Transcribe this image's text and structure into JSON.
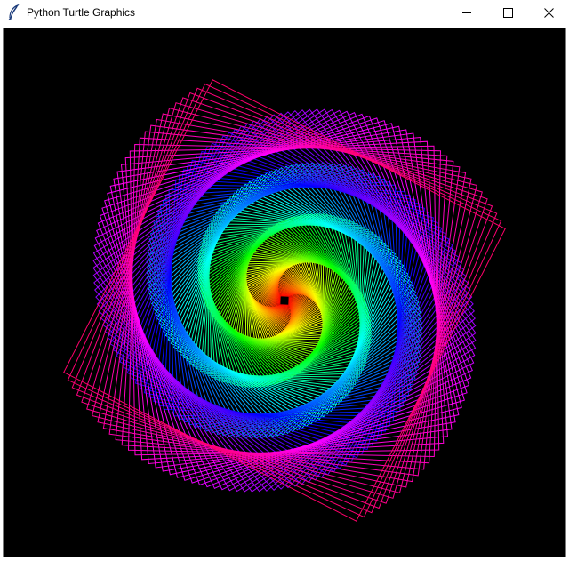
{
  "window": {
    "title": "Python Turtle Graphics",
    "icons": {
      "app": "feather-icon",
      "minimize": "minimize-icon",
      "maximize": "maximize-icon",
      "close": "close-icon"
    }
  },
  "canvas": {
    "background": "#000000",
    "pattern": "rainbow-square-spiral",
    "palette": [
      "#ff0000",
      "#ffff00",
      "#00ff00",
      "#00ffff",
      "#0000ff",
      "#ff00ff",
      "#ff0066"
    ]
  }
}
